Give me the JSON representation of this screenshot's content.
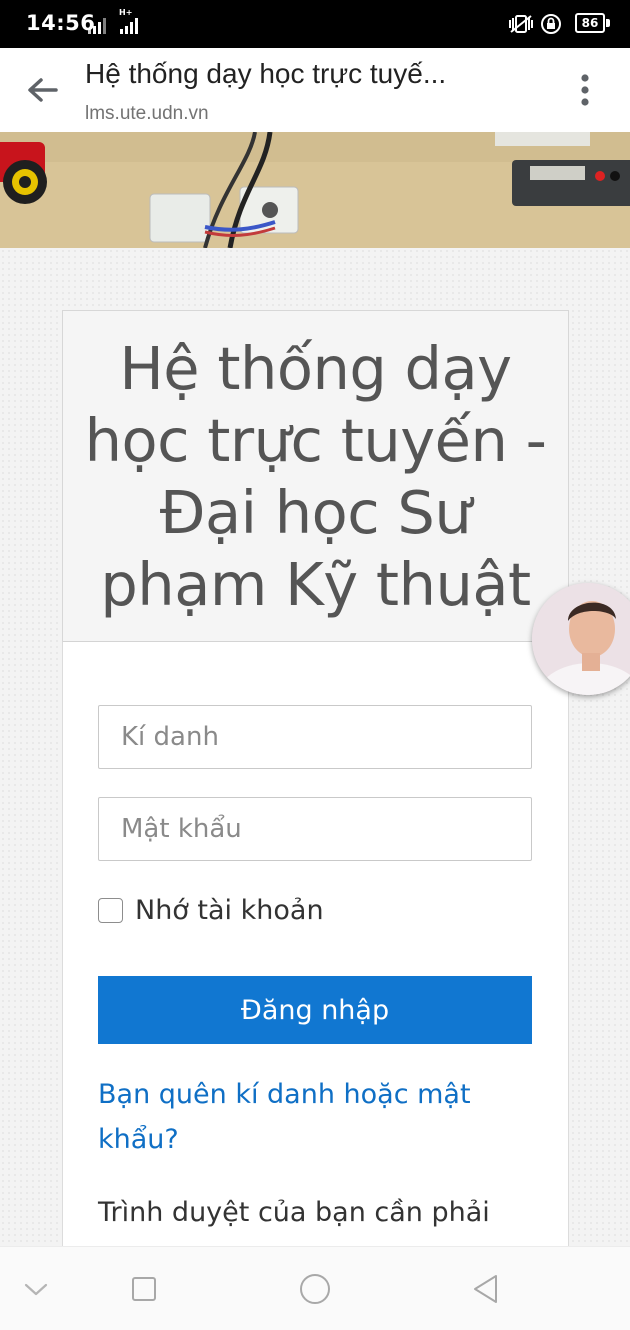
{
  "status_bar": {
    "time": "14:56",
    "battery": "86"
  },
  "app_bar": {
    "title": "Hệ thống dạy học trực tuyế...",
    "url": "lms.ute.udn.vn",
    "back_icon": "arrow-left-icon",
    "menu_icon": "more-vert-icon"
  },
  "login": {
    "heading": "Hệ thống dạy học trực tuyến - Đại học Sư phạm Kỹ thuật",
    "username_placeholder": "Kí danh",
    "password_placeholder": "Mật khẩu",
    "remember_label": "Nhớ tài khoản",
    "remember_checked": false,
    "login_button": "Đăng nhập",
    "forgot_link": "Bạn quên kí danh hoặc mật khẩu?",
    "cookie_notice": "Trình duyệt của bạn cần phải"
  },
  "colors": {
    "primary_button": "#1177d1",
    "link": "#0f6fc5",
    "heading_text": "#555555"
  },
  "nav_bar": {
    "icons": [
      "chevron-down-icon",
      "square-recents-icon",
      "circle-home-icon",
      "triangle-back-icon"
    ]
  }
}
